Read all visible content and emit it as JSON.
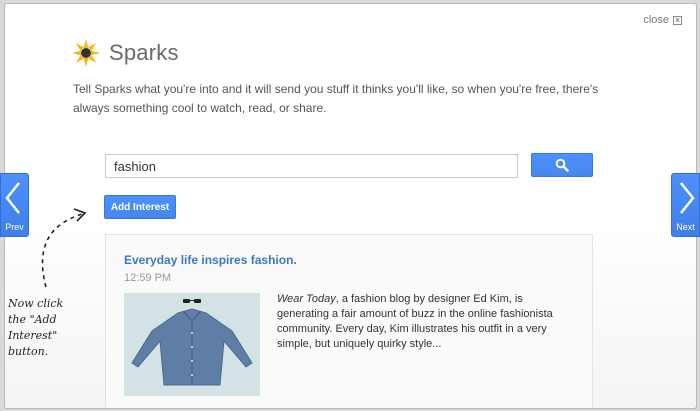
{
  "dialog": {
    "close_label": "close",
    "close_icon": "close-x-icon"
  },
  "brand": {
    "name": "Sparks",
    "logo_icon": "sparks-sun-icon"
  },
  "intro": "Tell Sparks what you're into and it will send you stuff it thinks you'll like, so when you're free, there's always something cool to watch, read, or share.",
  "search": {
    "value": "fashion",
    "placeholder": "",
    "button_icon": "magnifier-icon"
  },
  "add_interest": {
    "label": "Add Interest"
  },
  "result": {
    "title": "Everyday life inspires fashion.",
    "time": "12:59 PM",
    "thumbnail_icon": "shirt-illustration",
    "snippet_source": "Wear Today",
    "snippet_rest": ", a fashion blog by designer Ed Kim, is generating a fair amount of buzz in the online fashionista community. Every day, Kim illustrates his outfit in a very simple, but uniquely quirky style..."
  },
  "nav": {
    "prev_label": "Prev",
    "next_label": "Next",
    "prev_icon": "chevron-left-icon",
    "next_icon": "chevron-right-icon"
  },
  "annotation": {
    "lines": [
      "Now click",
      "the \"Add",
      "Interest\"",
      "button."
    ]
  },
  "colors": {
    "accent": "#4d90fe",
    "link": "#3b78c4",
    "logo_yellow": "#f5b91c"
  }
}
